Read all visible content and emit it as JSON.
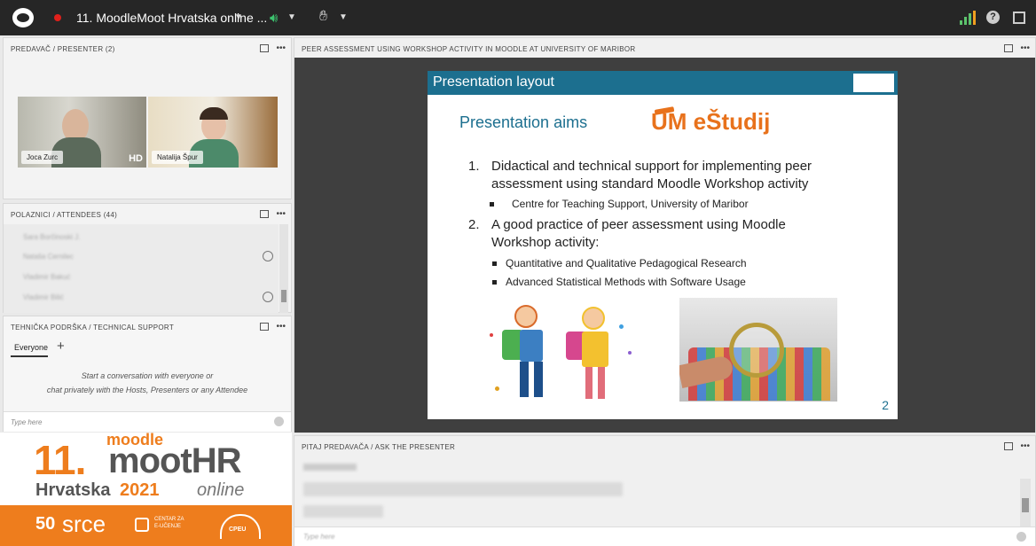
{
  "topbar": {
    "room_title": "11. MoodleMoot Hrvatska online ..."
  },
  "presenter_pod": {
    "title": "PREDAVAČ / PRESENTER (2)",
    "more": "•••",
    "videos": [
      {
        "name": "Joca Zurc",
        "badge": "HD"
      },
      {
        "name": "Natalija Špur"
      }
    ]
  },
  "attendees_pod": {
    "title": "POLAZNICI / ATTENDEES  (44)",
    "more": "•••",
    "attendees": [
      "Sara Borčinoski J.",
      "Nataša Cernilec",
      "Vladimir Bakuć",
      "Vladimir Bilić"
    ]
  },
  "support_pod": {
    "title": "TEHNIČKA PODRŠKA / TECHNICAL SUPPORT",
    "more": "•••",
    "tab_label": "Everyone",
    "add_tab": "+",
    "hint_line1": "Start a conversation with everyone or",
    "hint_line2": "chat privately with the Hosts, Presenters or any Attendee",
    "input_placeholder": "Type here"
  },
  "share_pod": {
    "title": "PEER ASSESSMENT USING WORKSHOP ACTIVITY IN MOODLE AT UNIVERSITY OF MARIBOR",
    "more": "•••"
  },
  "slide": {
    "header": "Presentation layout",
    "aims_title": "Presentation aims",
    "brand": "UM eŠtudij",
    "items": [
      {
        "num": "1.",
        "line1": "Didactical and technical support for implementing peer",
        "line2": "assessment using standard Moodle Workshop activity",
        "sub": [
          "Centre for Teaching Support, University of Maribor"
        ]
      },
      {
        "num": "2.",
        "line1": "A good practice of peer assessment using Moodle",
        "line2": "Workshop activity:",
        "sub": [
          "Quantitative and Qualitative Pedagogical Research",
          "Advanced Statistical Methods with Software Usage"
        ]
      }
    ],
    "page_number": "2"
  },
  "qa_pod": {
    "title": "PITAJ PREDAVAČA / ASK THE PRESENTER",
    "more": "•••",
    "input_placeholder": "Type here"
  },
  "branding": {
    "eleven": "11.",
    "moodle": "moodle",
    "moot": "mootHR",
    "hrvatska": "Hrvatska",
    "year": "2021",
    "online": "online",
    "srce": "srce",
    "srce_prefix": "50",
    "cpeu_line1": "CENTAR ZA",
    "cpeu_line2": "E-UČENJE",
    "cpeu": "CPEU"
  }
}
